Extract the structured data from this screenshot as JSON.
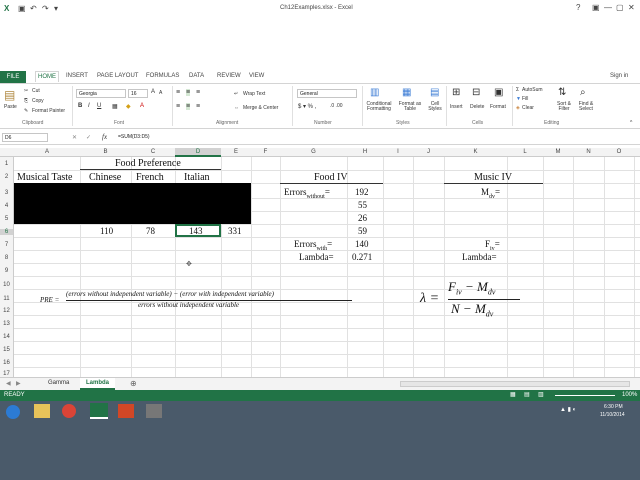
{
  "window": {
    "title": "Ch12Examples.xlsx - Excel",
    "controls": [
      "?",
      "▣",
      "—",
      "▢",
      "✕"
    ],
    "sign_in": "Sign in"
  },
  "ribbon_tabs": [
    "FILE",
    "HOME",
    "INSERT",
    "PAGE LAYOUT",
    "FORMULAS",
    "DATA",
    "REVIEW",
    "VIEW"
  ],
  "ribbon": {
    "clipboard": {
      "paste": "Paste",
      "cut": "Cut",
      "copy": "Copy",
      "format_painter": "Format Painter",
      "label": "Clipboard"
    },
    "font": {
      "name": "Georgia",
      "size": "16",
      "label": "Font"
    },
    "alignment": {
      "wrap": "Wrap Text",
      "merge": "Merge & Center",
      "label": "Alignment"
    },
    "number": {
      "format": "General",
      "label": "Number"
    },
    "styles": {
      "conditional": "Conditional Formatting",
      "format_table": "Format as Table",
      "cell_styles": "Cell Styles",
      "label": "Styles"
    },
    "cells": {
      "insert": "Insert",
      "delete": "Delete",
      "format": "Format",
      "label": "Cells"
    },
    "editing": {
      "autosum": "AutoSum",
      "fill": "Fill",
      "clear": "Clear",
      "sort": "Sort & Filter",
      "find": "Find & Select",
      "label": "Editing"
    }
  },
  "formula_bar": {
    "name_box": "D6",
    "fx": "fx",
    "formula": "=SUM(D3:D5)"
  },
  "columns": [
    "A",
    "B",
    "C",
    "D",
    "E",
    "F",
    "G",
    "H",
    "I",
    "J",
    "K",
    "L",
    "M",
    "N",
    "O"
  ],
  "rows": [
    "1",
    "2",
    "3",
    "4",
    "5",
    "6",
    "7",
    "8",
    "9",
    "10",
    "11",
    "12",
    "13",
    "14",
    "15",
    "16",
    "17"
  ],
  "cells": {
    "food_pref": "Food Preference",
    "musical_taste": "Musical Taste",
    "chinese": "Chinese",
    "french": "French",
    "italian": "Italian",
    "b6": "110",
    "c6": "78",
    "d6": "143",
    "e6": "331",
    "food_iv": "Food IV",
    "errors_without": "Errors",
    "errors_without_sub": "without",
    "errors_without_eq": "=",
    "h3": "192",
    "h4": "55",
    "h5": "26",
    "h6": "59",
    "errors_with": "Errors",
    "errors_with_sub": "with",
    "errors_with_eq": "=",
    "h7": "140",
    "lambda_label": "Lambda=",
    "h8": "0.271",
    "music_iv": "Music IV",
    "mdv": "M",
    "mdv_sub": "dv",
    "mdv_eq": "=",
    "fiv": "F",
    "fiv_sub": "iv",
    "fiv_eq": "=",
    "lambda_label2": "Lambda="
  },
  "pre_formula": {
    "lhs": "PRE =",
    "numerator": "(errors without independent variable) − (error with independent variable)",
    "denominator": "errors without independent variable"
  },
  "lambda_formula": {
    "lhs": "λ =",
    "num_f": "F",
    "num_f_sub": "iv",
    "num_minus": " − M",
    "num_m_sub": "dv",
    "den_n": "N − M",
    "den_m_sub": "dv"
  },
  "sheets": [
    "Gamma",
    "Lambda"
  ],
  "active_sheet": "Lambda",
  "status": {
    "ready": "READY",
    "zoom": "100%"
  },
  "taskbar": {
    "time": "6:30 PM",
    "date": "11/10/2014"
  },
  "colors": {
    "excel_green": "#217346"
  }
}
